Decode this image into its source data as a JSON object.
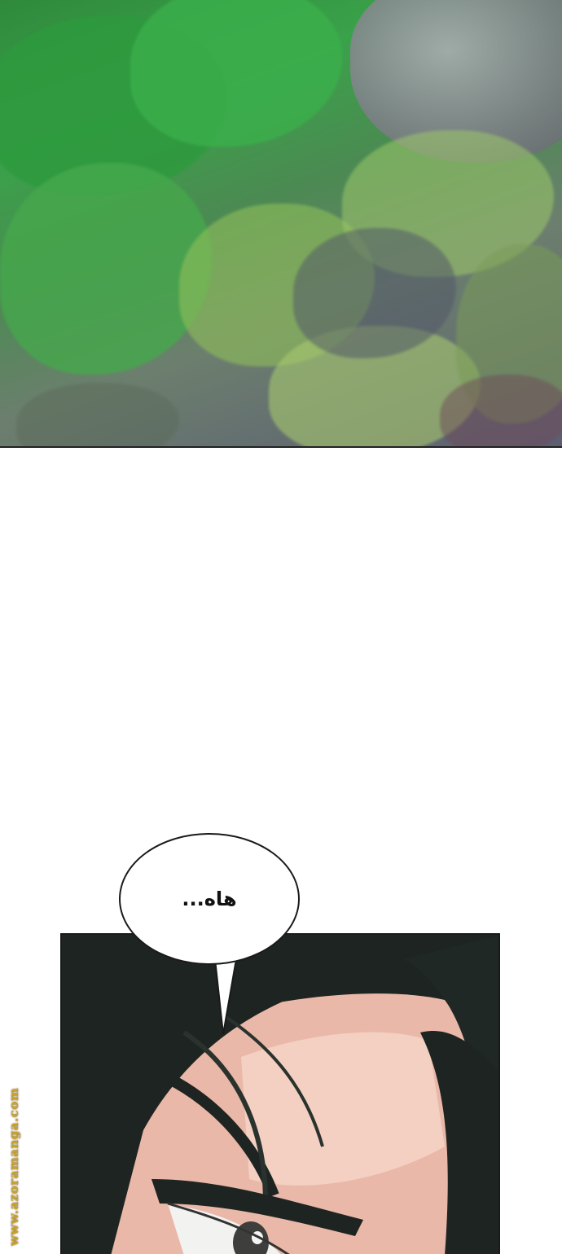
{
  "panels": {
    "top": {
      "description_colors": {
        "foliage": "#3aa24a",
        "shadow": "#5c5e72",
        "rock": "#9a9ea3"
      }
    },
    "character": {
      "colors": {
        "hair": "#1e2421",
        "skin": "#e9b8a8",
        "skin_light": "#f5d6c8"
      }
    }
  },
  "speech_bubble": {
    "text": "هاه..."
  },
  "watermark": {
    "text": "www.azoramanga.com",
    "color": "#c9a227"
  }
}
